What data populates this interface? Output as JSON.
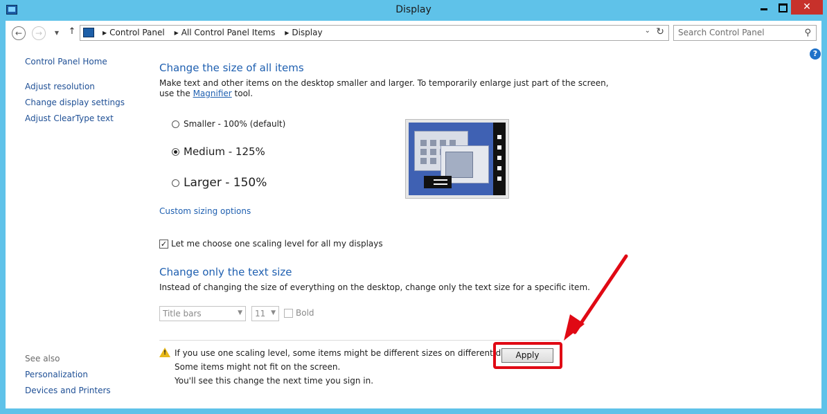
{
  "window": {
    "title": "Display"
  },
  "nav": {
    "breadcrumb": [
      "Control Panel",
      "All Control Panel Items",
      "Display"
    ],
    "search_placeholder": "Search Control Panel"
  },
  "sidebar": {
    "home": "Control Panel Home",
    "links": [
      "Adjust resolution",
      "Change display settings",
      "Adjust ClearType text"
    ],
    "see_also_label": "See also",
    "see_also": [
      "Personalization",
      "Devices and Printers"
    ]
  },
  "size_section": {
    "heading": "Change the size of all items",
    "desc_line1": "Make text and other items on the desktop smaller and larger. To temporarily enlarge just part of the screen,",
    "desc_line2_prefix": "use the ",
    "magnifier_link": "Magnifier",
    "desc_line2_suffix": " tool.",
    "options": [
      {
        "label": "Smaller - 100% (default)",
        "selected": false
      },
      {
        "label": "Medium - 125%",
        "selected": true
      },
      {
        "label": "Larger - 150%",
        "selected": false
      }
    ],
    "custom_link": "Custom sizing options",
    "scaling_checkbox": {
      "label": "Let me choose one scaling level for all my displays",
      "checked": true
    }
  },
  "text_section": {
    "heading": "Change only the text size",
    "desc": "Instead of changing the size of everything on the desktop, change only the text size for a specific item.",
    "item_select": "Title bars",
    "size_select": "11",
    "bold_label": "Bold"
  },
  "warning": {
    "line1": "If you use one scaling level, some items might be different sizes on different displays.",
    "line2": "Some items might not fit on the screen.",
    "line3": "You'll see this change the next time you sign in."
  },
  "apply_button": "Apply",
  "colors": {
    "title_bar": "#5fc2e9",
    "link": "#1e5fb0",
    "annotation": "#e00914",
    "close": "#c7312b"
  }
}
